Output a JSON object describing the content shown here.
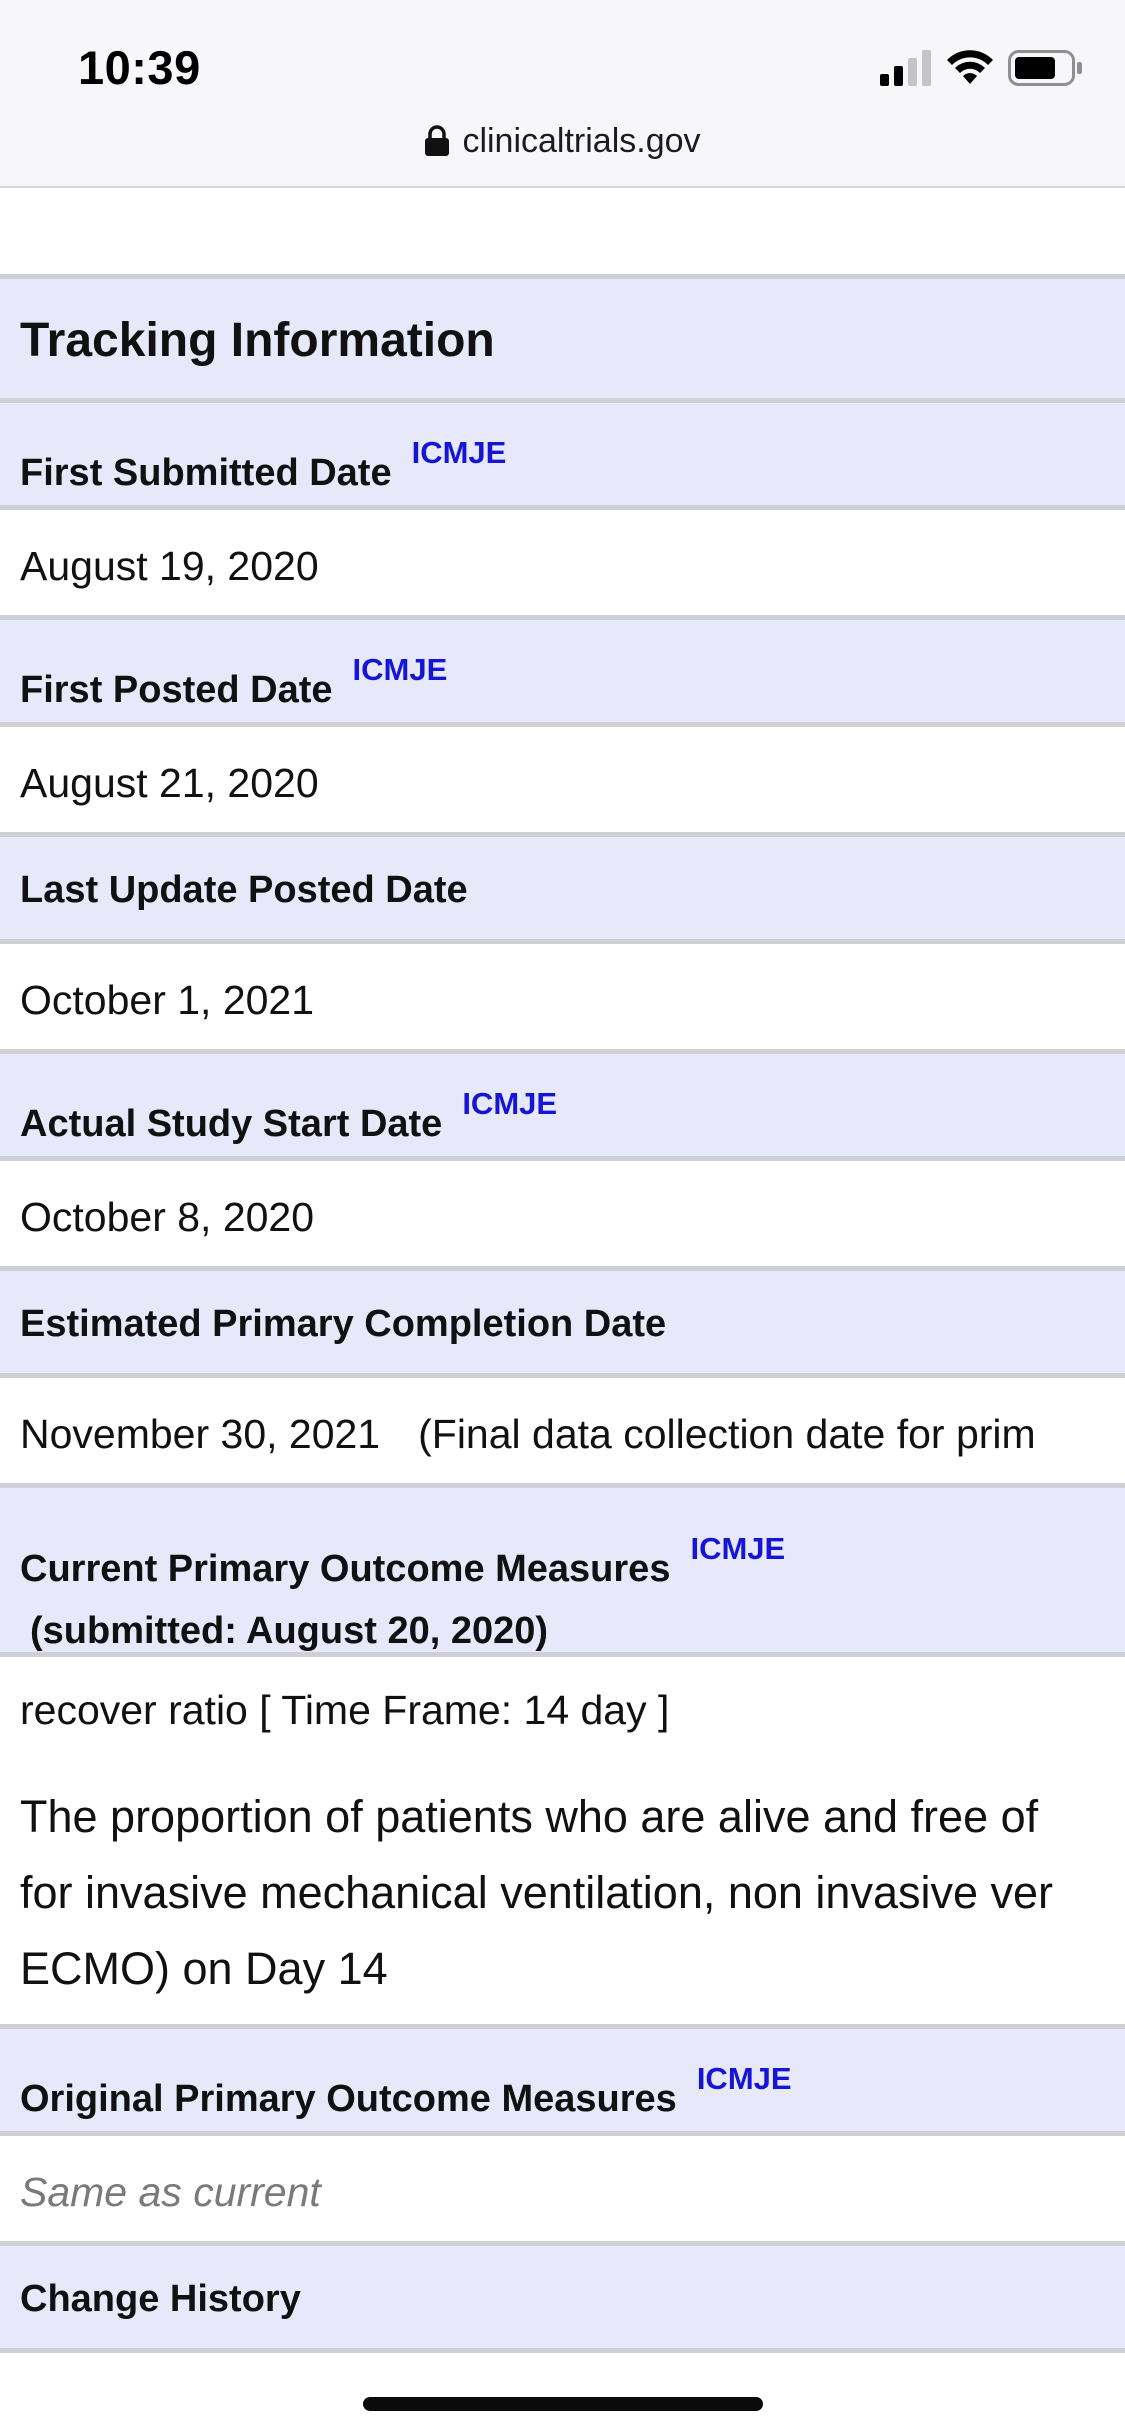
{
  "status_bar": {
    "time": "10:39",
    "icons": [
      "signal-icon",
      "wifi-icon",
      "battery-icon"
    ]
  },
  "browser": {
    "url": "clinicaltrials.gov",
    "icon": "lock-icon"
  },
  "colors": {
    "header_bg": "#e8e8fb",
    "divider": "#cfcfd6",
    "icmje_link": "#1515d6",
    "placeholder_text": "#7a7a7a"
  },
  "section": {
    "title": "Tracking Information"
  },
  "fields": {
    "first_submitted": {
      "label": "First Submitted Date",
      "badge": "ICMJE",
      "value": "August 19, 2020"
    },
    "first_posted": {
      "label": "First Posted Date",
      "badge": "ICMJE",
      "value": "August 21, 2020"
    },
    "last_update": {
      "label": "Last Update Posted Date",
      "value": "October 1, 2021"
    },
    "study_start": {
      "label": "Actual Study Start Date",
      "badge": "ICMJE",
      "value": "October 8, 2020"
    },
    "primary_completion": {
      "label": "Estimated Primary Completion Date",
      "value": "November 30, 2021",
      "note": "(Final data collection date for prim"
    },
    "current_outcomes": {
      "label": "Current Primary Outcome Measures",
      "badge": "ICMJE",
      "sublabel": "(submitted: August 20, 2020)",
      "measure_title": "recover ratio [ Time Frame: 14 day ]",
      "description_lines": [
        "The proportion of patients who are alive and free of",
        "for invasive mechanical ventilation, non invasive ver",
        "ECMO) on Day 14"
      ]
    },
    "original_outcomes": {
      "label": "Original Primary Outcome Measures",
      "badge": "ICMJE",
      "value": "Same as current"
    },
    "change_history": {
      "label": "Change History"
    }
  }
}
